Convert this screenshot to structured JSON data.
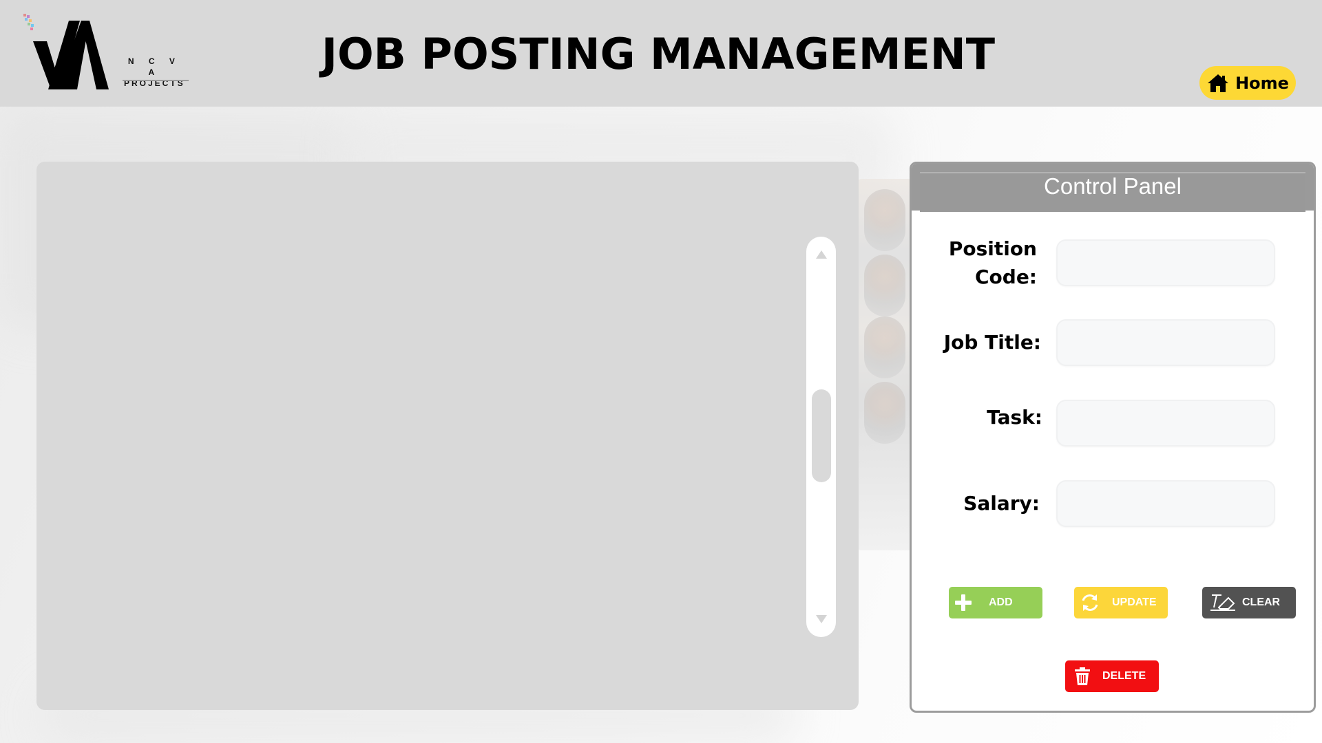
{
  "header": {
    "logo": {
      "line1": "N C V A",
      "line2": "PROJECTS"
    },
    "title": "JOB POSTING MANAGEMENT",
    "home_button": {
      "label": "Home",
      "icon": "home-icon",
      "color": "#fdd835"
    }
  },
  "data_panel": {
    "scrollbar": {
      "up_icon": "triangle-up-icon",
      "down_icon": "triangle-down-icon"
    }
  },
  "control_panel": {
    "title": "Control Panel",
    "fields": [
      {
        "label": "Position Code:",
        "value": "",
        "placeholder": ""
      },
      {
        "label": "Job Title:",
        "value": "",
        "placeholder": ""
      },
      {
        "label": "Task:",
        "value": "",
        "placeholder": ""
      },
      {
        "label": "Salary:",
        "value": "",
        "placeholder": ""
      }
    ],
    "buttons": {
      "add": {
        "label": "ADD",
        "icon": "plus-icon",
        "color": "#96cf57"
      },
      "update": {
        "label": "UPDATE",
        "icon": "refresh-icon",
        "color": "#fcd63a"
      },
      "clear": {
        "label": "CLEAR",
        "icon": "eraser-icon",
        "color": "#525252"
      },
      "delete": {
        "label": "DELETE",
        "icon": "trash-icon",
        "color": "#f20f12"
      }
    }
  }
}
